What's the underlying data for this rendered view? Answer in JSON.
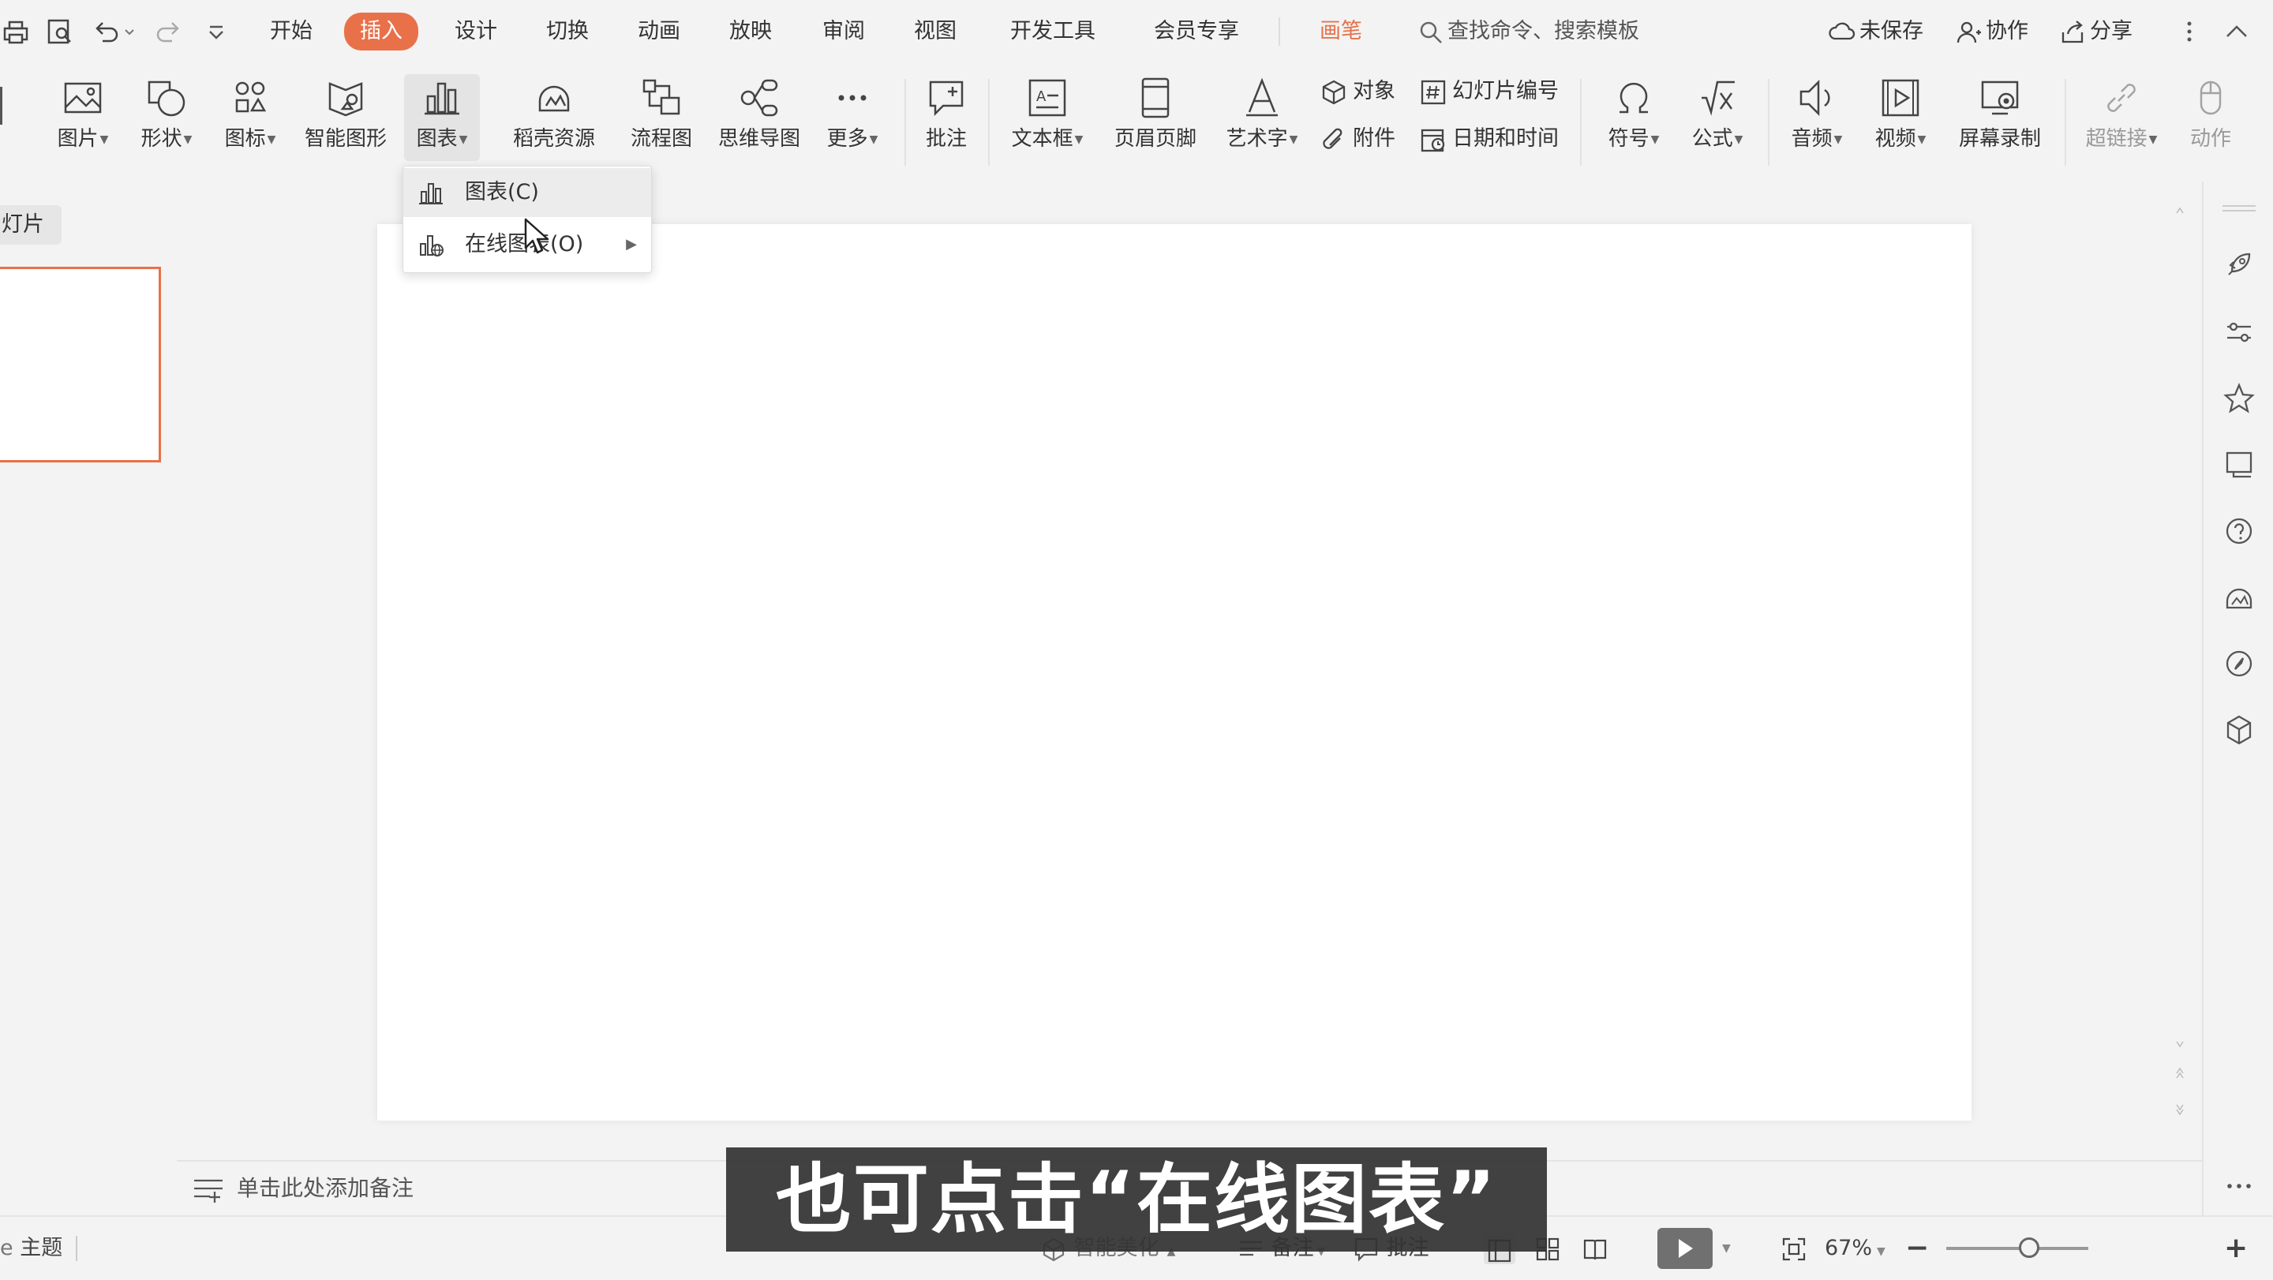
{
  "tabs": {
    "start": "开始",
    "insert": "插入",
    "design": "设计",
    "transition": "切换",
    "animation": "动画",
    "slideshow": "放映",
    "review": "审阅",
    "view": "视图",
    "devtools": "开发工具",
    "member": "会员专享",
    "pen": "画笔"
  },
  "search": {
    "placeholder": "查找命令、搜索模板"
  },
  "header_actions": {
    "unsaved": "未保存",
    "collab": "协作",
    "share": "分享"
  },
  "ribbon": {
    "picture": "图片",
    "shape": "形状",
    "icon": "图标",
    "smartart": "智能图形",
    "chart": "图表",
    "docer": "稻壳资源",
    "flowchart": "流程图",
    "mindmap": "思维导图",
    "more": "更多",
    "comment": "批注",
    "textbox": "文本框",
    "header_footer": "页眉页脚",
    "wordart": "艺术字",
    "object": "对象",
    "attachment": "附件",
    "slide_number": "幻灯片编号",
    "datetime": "日期和时间",
    "symbol": "符号",
    "formula": "公式",
    "audio": "音频",
    "video": "视频",
    "screen_record": "屏幕录制",
    "hyperlink": "超链接",
    "action": "动作"
  },
  "chart_menu": {
    "items": [
      {
        "label": "图表(C)"
      },
      {
        "label": "在线图表(O)"
      }
    ]
  },
  "left_panel": {
    "tab_label": "灯片"
  },
  "notes": {
    "placeholder": "单击此处添加备注"
  },
  "status": {
    "theme": "主题",
    "smart_beautify": "智能美化",
    "notes": "备注",
    "comments": "批注",
    "zoom": "67%"
  },
  "subtitle": "也可点击“在线图表”",
  "colors": {
    "accent": "#e8714a",
    "background": "#f3f3f3"
  }
}
